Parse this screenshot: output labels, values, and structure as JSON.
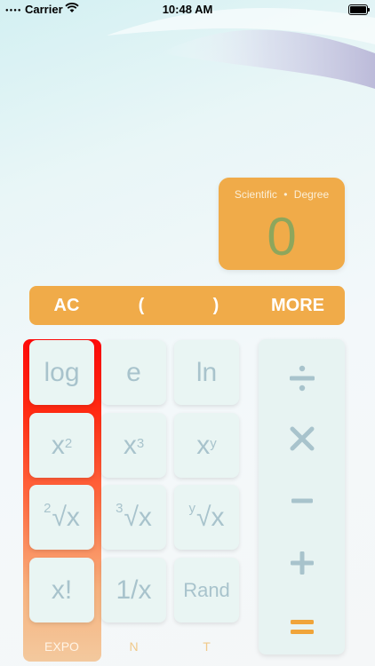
{
  "status_bar": {
    "carrier": "Carrier",
    "time": "10:48 AM"
  },
  "display": {
    "mode_left": "Scientific",
    "mode_sep": "•",
    "mode_right": "Degree",
    "value": "0"
  },
  "top_bar": {
    "clear": "AC",
    "open_paren": "(",
    "close_paren": ")",
    "more": "MORE"
  },
  "keys": {
    "log": "log",
    "e": "e",
    "ln": "ln",
    "x_sq_base": "x",
    "x_sq_exp": "2",
    "x_cube_base": "x",
    "x_cube_exp": "3",
    "x_y_base": "x",
    "x_y_exp": "y",
    "sqrt2_index": "2",
    "sqrt2_body": "√x",
    "sqrt3_index": "3",
    "sqrt3_body": "√x",
    "sqrty_index": "y",
    "sqrty_body": "√x",
    "factorial": "x!",
    "reciprocal": "1/x",
    "rand": "Rand"
  },
  "column_labels": {
    "expo": "EXPO",
    "n": "N",
    "t": "T"
  },
  "operators": {
    "divide": "÷",
    "multiply": "×",
    "minus": "−",
    "plus": "+",
    "equals": "="
  },
  "colors": {
    "accent_orange": "#f0ab49",
    "display_digit": "#8ea65c",
    "key_text": "#a8c3cc",
    "expo_red": "#ff0a0a",
    "equals_orange": "#f0a43a"
  }
}
